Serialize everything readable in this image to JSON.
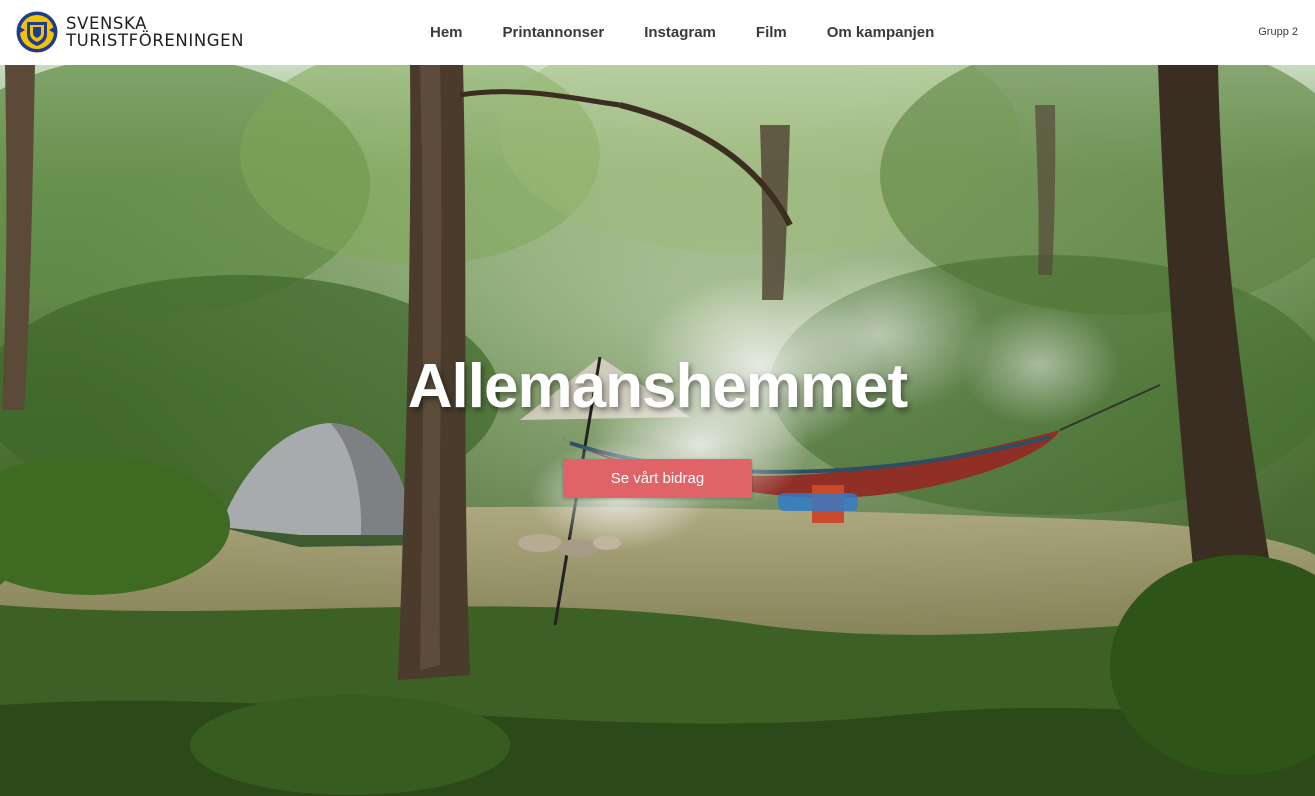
{
  "header": {
    "logo": {
      "line1": "SVENSKA",
      "line2": "TURISTFÖRENINGEN"
    },
    "nav": [
      {
        "label": "Hem"
      },
      {
        "label": "Printannonser"
      },
      {
        "label": "Instagram"
      },
      {
        "label": "Film"
      },
      {
        "label": "Om kampanjen"
      }
    ],
    "group_label": "Grupp 2"
  },
  "hero": {
    "title": "Allemanshemmet",
    "button_label": "Se vårt bidrag",
    "background": "forest-campsite-photo"
  },
  "colors": {
    "button": "#e06467",
    "logo_blue": "#1f3b8f",
    "logo_yellow": "#f2c300"
  }
}
